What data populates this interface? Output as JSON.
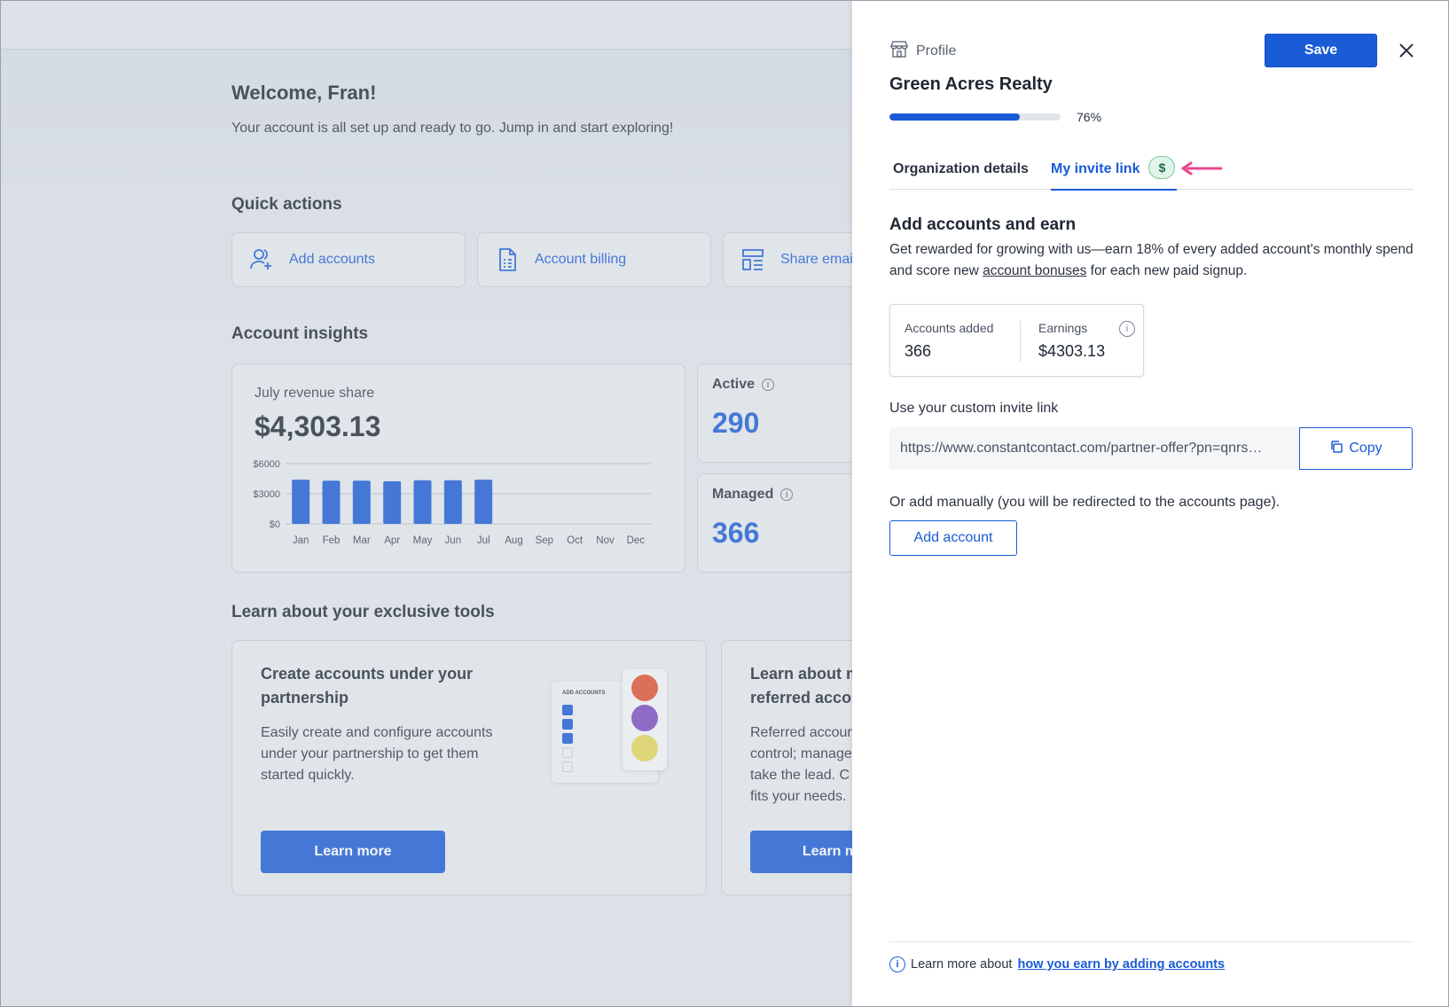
{
  "background": {
    "welcome_title": "Welcome, Fran!",
    "welcome_subtitle": "Your account is all set up and ready to go. Jump in and start exploring!",
    "quick_actions": {
      "heading": "Quick actions",
      "items": [
        {
          "label": "Add accounts",
          "icon": "add-user-icon"
        },
        {
          "label": "Account billing",
          "icon": "document-icon"
        },
        {
          "label": "Share emai",
          "icon": "share-layout-icon"
        }
      ]
    },
    "insights": {
      "heading": "Account insights",
      "revenue_label": "July revenue share",
      "revenue_value": "$4,303.13",
      "active_label": "Active",
      "active_value": "290",
      "managed_label": "Managed",
      "managed_value": "366"
    },
    "tools": {
      "heading": "Learn about your exclusive tools",
      "cards": [
        {
          "title": "Create accounts under your partnership",
          "text": "Easily create and configure accounts under your partnership to get them started quickly.",
          "button": "Learn more",
          "illustration_label": "ADD ACCOUNTS"
        },
        {
          "title": "Learn about m referred accou",
          "text": "Referred accour control; manage take the lead. C fits your needs.",
          "button": "Learn m"
        }
      ]
    }
  },
  "chart_data": {
    "type": "bar",
    "title": "",
    "categories": [
      "Jan",
      "Feb",
      "Mar",
      "Apr",
      "May",
      "Jun",
      "Jul",
      "Aug",
      "Sep",
      "Oct",
      "Nov",
      "Dec"
    ],
    "values": [
      4400,
      4300,
      4300,
      4250,
      4350,
      4350,
      4400,
      null,
      null,
      null,
      null,
      null
    ],
    "ylim": [
      0,
      6000
    ],
    "y_ticks": [
      "$6000",
      "$3000",
      "$0"
    ],
    "y_tick_values": [
      6000,
      3000,
      0
    ],
    "grid": true,
    "bar_color": "#1a5bd6"
  },
  "drawer": {
    "header_label": "Profile",
    "save_label": "Save",
    "org_name": "Green Acres Realty",
    "progress_percent": 76,
    "progress_text": "76%",
    "tabs": [
      {
        "label": "Organization details",
        "active": false
      },
      {
        "label": "My invite link",
        "active": true,
        "badge": "$"
      }
    ],
    "section_title": "Add accounts and earn",
    "description_before": "Get rewarded for growing with us—earn 18% of every added account's monthly spend and score new ",
    "description_link": "account bonuses",
    "description_after": " for each new paid signup.",
    "stats": {
      "accounts_added_label": "Accounts added",
      "accounts_added_value": "366",
      "earnings_label": "Earnings",
      "earnings_value": "$4303.13"
    },
    "invite_label": "Use your custom invite link",
    "invite_url": "https://www.constantcontact.com/partner-offer?pn=qnrs…",
    "copy_label": "Copy",
    "manual_text": "Or add manually (you will be redirected to the accounts page).",
    "add_account_label": "Add account",
    "footer_text": "Learn more about",
    "footer_link": "how you earn by adding accounts"
  },
  "colors": {
    "accent": "#1a5bd6",
    "badge_green": "#dff5ea",
    "arrow_pink": "#e8488f"
  }
}
